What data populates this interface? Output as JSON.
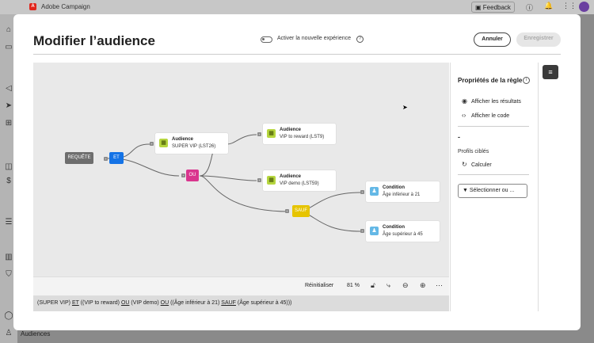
{
  "app": {
    "title": "Adobe Campaign",
    "feedback_label": "Feedback",
    "bottom_label": "Audiences"
  },
  "modal": {
    "title": "Modifier l’audience",
    "toggle_label": "Activer la nouvelle expérience",
    "cancel_label": "Annuler",
    "save_label": "Enregistrer"
  },
  "canvas": {
    "query_label": "REQUÊTE",
    "and_label": "ET",
    "or_label": "OU",
    "except_label": "SAUF",
    "nodes": [
      {
        "title": "Audience",
        "subtitle": "SUPER VIP (LST26)"
      },
      {
        "title": "Audience",
        "subtitle": "VIP to reward (LST9)"
      },
      {
        "title": "Audience",
        "subtitle": "VIP demo (LST59)"
      },
      {
        "title": "Condition",
        "subtitle": "Âge inférieur à 21"
      },
      {
        "title": "Condition",
        "subtitle": "Âge supérieur à 45"
      }
    ],
    "colors": {
      "and": "#1473e6",
      "or": "#d9358e",
      "except": "#e6c400",
      "query": "#6e6e6e"
    }
  },
  "zoombar": {
    "reset_label": "Réinitialiser",
    "zoom": "81 %"
  },
  "formula": {
    "p1": "(SUPER VIP) ",
    "op1": "ET",
    "p2": " ((VIP to reward) ",
    "op2": "OU",
    "p3": " (VIP demo) ",
    "op3": "OU",
    "p4": " ((Âge inférieur à 21) ",
    "op4": "SAUF",
    "p5": " (Âge supérieur à 45)))"
  },
  "panel": {
    "title": "Propriétés de la règle",
    "show_results": "Afficher les résultats",
    "show_code": "Afficher le code",
    "dash": "-",
    "targeted_label": "Profils ciblés",
    "compute_label": "Calculer",
    "select_label": "Sélectionner ou ..."
  }
}
